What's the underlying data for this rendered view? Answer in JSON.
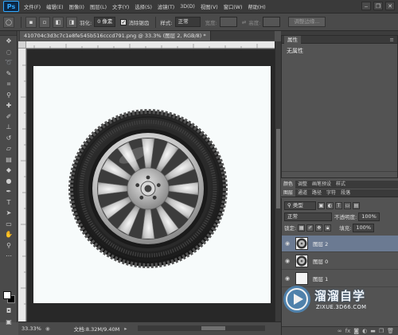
{
  "app": {
    "logo": "Ps"
  },
  "menu": [
    "文件(F)",
    "编辑(E)",
    "图像(I)",
    "图层(L)",
    "文字(Y)",
    "选择(S)",
    "滤镜(T)",
    "3D(D)",
    "视图(V)",
    "窗口(W)",
    "帮助(H)"
  ],
  "window_controls": {
    "minimize": "‒",
    "restore": "❐",
    "close": "✕"
  },
  "options": {
    "feather_label": "羽化:",
    "feather_value": "0 像素",
    "antialias_label": "消除锯齿",
    "antialias_checked": true,
    "style_label": "样式:",
    "style_value": "正常",
    "width_label": "宽度:",
    "height_label": "高度:",
    "refine_edge_button": "调整边缘..."
  },
  "document": {
    "tab_title": "410704c3d3c7c1e8fe545b516cccd791.png @ 33.3% (图层 2, RGB/8) *",
    "zoom": "33.33%",
    "info": "文档:8.32M/9.40M"
  },
  "properties_panel": {
    "tab": "属性",
    "empty_text": "无属性"
  },
  "color_tabs": [
    "颜色",
    "调整",
    "画笔预设",
    "样式"
  ],
  "layer_tabs": [
    "图层",
    "通道",
    "路径",
    "字符",
    "段落"
  ],
  "layers_panel": {
    "kind_filter": "类型",
    "blend_mode": "正常",
    "opacity_label": "不透明度:",
    "opacity_value": "100%",
    "lock_label": "锁定:",
    "fill_label": "填充:",
    "fill_value": "100%",
    "layers": [
      {
        "name": "图层 2",
        "selected": true
      },
      {
        "name": "图层 0",
        "selected": false
      },
      {
        "name": "图层 1",
        "selected": false
      }
    ]
  },
  "watermark": {
    "title": "溜溜自学",
    "url": "ZIXUE.3D66.COM"
  },
  "colors": {
    "accent_selected_layer": "#6b7a92",
    "ps_blue": "#31a8ff",
    "canvas_bg": "#f7fbfb"
  },
  "icons": [
    "marquee-icon",
    "move-icon",
    "lasso-icon",
    "eye-icon",
    "link-icon",
    "trash-icon",
    "new-layer-icon",
    "folder-icon"
  ]
}
